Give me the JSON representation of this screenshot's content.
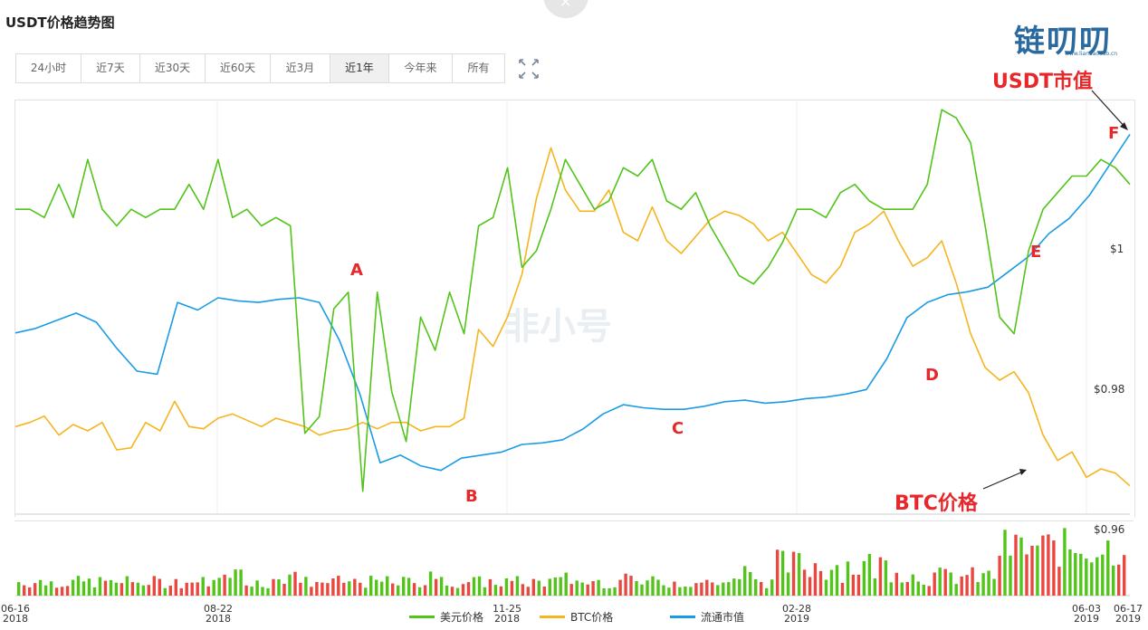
{
  "page": {
    "title": "USDT价格趋势图",
    "watermark": "非小号"
  },
  "logo": {
    "text": "链叨叨",
    "sub": "www.liandaodao.cn"
  },
  "tabs": [
    {
      "label": "24小时",
      "active": false
    },
    {
      "label": "近7天",
      "active": false
    },
    {
      "label": "近30天",
      "active": false
    },
    {
      "label": "近60天",
      "active": false
    },
    {
      "label": "近3月",
      "active": false
    },
    {
      "label": "近1年",
      "active": true
    },
    {
      "label": "今年来",
      "active": false
    },
    {
      "label": "所有",
      "active": false
    }
  ],
  "icons": {
    "expand": "expand-icon",
    "close": "close-icon"
  },
  "chart_data": {
    "type": "line",
    "y_ticks": [
      "$1",
      "$0.98",
      "$0.96"
    ],
    "x_ticks": [
      {
        "date": "06-16",
        "year": "2018"
      },
      {
        "date": "08-22",
        "year": "2018"
      },
      {
        "date": "11-25",
        "year": "2018"
      },
      {
        "date": "02-28",
        "year": "2019"
      },
      {
        "date": "06-03",
        "year": "2019"
      },
      {
        "date": "06-17",
        "year": "2019"
      }
    ],
    "legend": [
      {
        "name": "美元价格",
        "color": "#52c41a"
      },
      {
        "name": "BTC价格",
        "color": "#f5b51f"
      },
      {
        "name": "流通市值",
        "color": "#1a9be6"
      }
    ],
    "annotations": [
      "A",
      "B",
      "C",
      "D",
      "E",
      "F"
    ],
    "callouts": [
      "USDT市值",
      "BTC价格"
    ],
    "colors": {
      "usd": "#52c41a",
      "btc": "#f5b51f",
      "cap": "#1a9be6",
      "vol_up": "#52c41a",
      "vol_down": "#e8483f",
      "annotation": "#e8272b"
    },
    "series": [
      {
        "name": "美元价格",
        "values": [
          1.0,
          1.0,
          0.999,
          1.003,
          0.999,
          1.006,
          1.0,
          0.998,
          1.0,
          0.999,
          1.0,
          1.0,
          1.003,
          1.0,
          1.006,
          0.999,
          1.0,
          0.998,
          0.999,
          0.998,
          0.973,
          0.975,
          0.988,
          0.99,
          0.966,
          0.99,
          0.978,
          0.972,
          0.987,
          0.983,
          0.99,
          0.985,
          0.998,
          0.999,
          1.005,
          0.993,
          0.995,
          1.0,
          1.006,
          1.003,
          1.0,
          1.001,
          1.005,
          1.004,
          1.006,
          1.001,
          1.0,
          1.002,
          0.998,
          0.995,
          0.992,
          0.991,
          0.993,
          0.996,
          1.0,
          1.0,
          0.999,
          1.002,
          1.003,
          1.001,
          1.0,
          1.0,
          1.0,
          1.003,
          1.012,
          1.011,
          1.008,
          0.998,
          0.987,
          0.985,
          0.995,
          1.0,
          1.002,
          1.004,
          1.004,
          1.006,
          1.005,
          1.003
        ]
      },
      {
        "name": "BTC价格",
        "values": [
          6400,
          6500,
          6650,
          6200,
          6450,
          6300,
          6500,
          5850,
          5900,
          6500,
          6300,
          7000,
          6400,
          6350,
          6600,
          6700,
          6550,
          6400,
          6600,
          6500,
          6400,
          6200,
          6300,
          6350,
          6500,
          6350,
          6500,
          6500,
          6300,
          6400,
          6400,
          6600,
          8700,
          8300,
          9000,
          10000,
          11800,
          13000,
          12000,
          11500,
          11500,
          12000,
          11000,
          10800,
          11600,
          10800,
          10500,
          10900,
          11300,
          11500,
          11400,
          11200,
          10800,
          11000,
          10500,
          10000,
          9800,
          10200,
          11000,
          11200,
          11500,
          10800,
          10200,
          10400,
          10800,
          9800,
          8600,
          7800,
          7500,
          7700,
          7200,
          6200,
          5600,
          5800,
          5200,
          5400,
          5300,
          5000
        ]
      },
      {
        "name": "流通市值",
        "values": [
          2.65,
          2.68,
          2.73,
          2.78,
          2.72,
          2.55,
          2.4,
          2.38,
          2.85,
          2.8,
          2.88,
          2.86,
          2.85,
          2.87,
          2.88,
          2.85,
          2.6,
          2.25,
          1.8,
          1.85,
          1.78,
          1.75,
          1.83,
          1.85,
          1.87,
          1.92,
          1.93,
          1.95,
          2.02,
          2.12,
          2.18,
          2.16,
          2.15,
          2.15,
          2.17,
          2.2,
          2.21,
          2.19,
          2.2,
          2.22,
          2.23,
          2.25,
          2.28,
          2.48,
          2.75,
          2.85,
          2.9,
          2.92,
          2.95,
          3.05,
          3.15,
          3.3,
          3.4,
          3.55,
          3.75,
          3.95
        ]
      }
    ]
  }
}
